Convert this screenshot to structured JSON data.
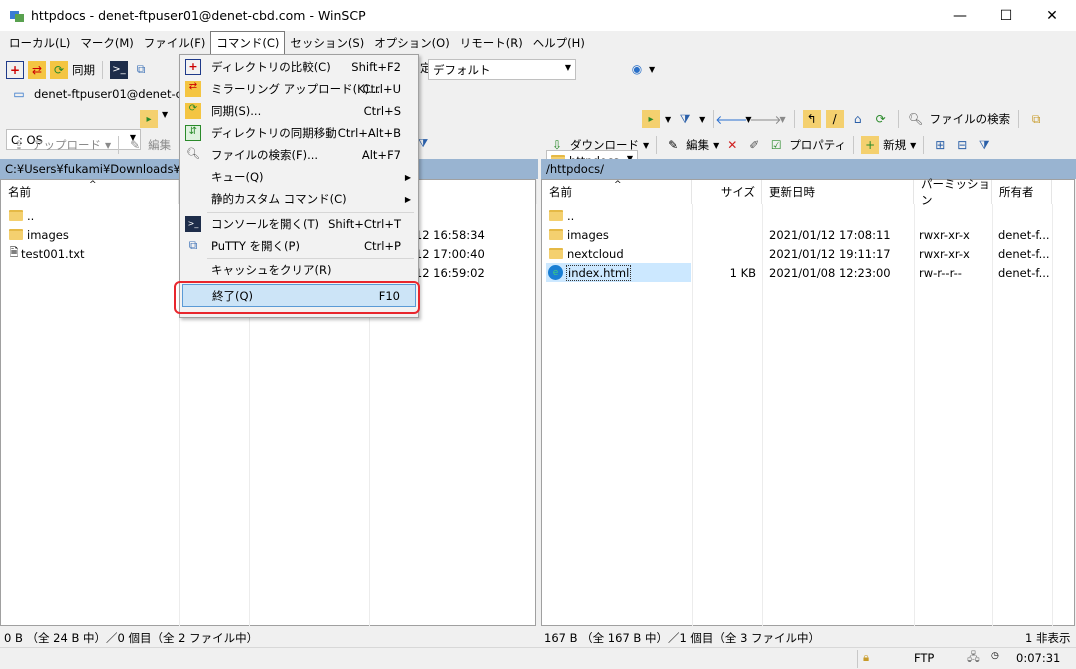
{
  "window": {
    "title": "httpdocs - denet-ftpuser01@denet-cbd.com - WinSCP",
    "minimize": "—",
    "maximize": "☐",
    "close": "✕"
  },
  "menubar": {
    "items": [
      "ローカル(L)",
      "マーク(M)",
      "ファイル(F)",
      "コマンド(C)",
      "セッション(S)",
      "オプション(O)",
      "リモート(R)",
      "ヘルプ(H)"
    ]
  },
  "toolbar": {
    "sync_label": "同期",
    "transfer_setting": "デフォルト"
  },
  "session": {
    "label": "denet-ftpuser01@denet-cbd"
  },
  "left": {
    "drive": "C: OS",
    "upload": "アップロード",
    "edit": "編集",
    "path": "C:¥Users¥fukami¥Downloads¥htt",
    "col_name": "名前",
    "col_date": "時",
    "rows": [
      {
        "name": "..",
        "date": ""
      },
      {
        "name": "images",
        "date": "/12  16:58:34"
      },
      {
        "name": "test001.txt",
        "date": "/12  17:00:40"
      },
      {
        "name": "",
        "date": "/12  16:59:02"
      }
    ],
    "status": "0 B （全 24 B 中）／0 個目（全 2 ファイル中）"
  },
  "right": {
    "dir": "httpdocs",
    "download": "ダウンロード",
    "edit": "編集",
    "properties": "プロパティ",
    "new": "新規",
    "find": "ファイルの検索",
    "path": "/httpdocs/",
    "cols": {
      "name": "名前",
      "size": "サイズ",
      "date": "更新日時",
      "perm": "パーミッション",
      "owner": "所有者"
    },
    "rows": [
      {
        "name": "..",
        "size": "",
        "date": "",
        "perm": "",
        "owner": ""
      },
      {
        "name": "images",
        "size": "",
        "date": "2021/01/12 17:08:11",
        "perm": "rwxr-xr-x",
        "owner": "denet-f..."
      },
      {
        "name": "nextcloud",
        "size": "",
        "date": "2021/01/12 19:11:17",
        "perm": "rwxr-xr-x",
        "owner": "denet-f..."
      },
      {
        "name": "index.html",
        "size": "1 KB",
        "date": "2021/01/08 12:23:00",
        "perm": "rw-r--r--",
        "owner": "denet-f..."
      }
    ],
    "status": "167 B （全 167 B 中）／1 個目（全 3 ファイル中）",
    "hidden": "1 非表示"
  },
  "statusbar": {
    "protocol": "FTP",
    "time": "0:07:31"
  },
  "command_menu": {
    "items": [
      {
        "label": "ディレクトリの比較(C)",
        "shortcut": "Shift+F2"
      },
      {
        "label": "ミラーリング アップロード(K)...",
        "shortcut": "Ctrl+U"
      },
      {
        "label": "同期(S)...",
        "shortcut": "Ctrl+S"
      },
      {
        "label": "ディレクトリの同期移動",
        "shortcut": "Ctrl+Alt+B"
      },
      {
        "label": "ファイルの検索(F)...",
        "shortcut": "Alt+F7"
      },
      {
        "label": "キュー(Q)",
        "shortcut": ""
      },
      {
        "label": "静的カスタム コマンド(C)",
        "shortcut": ""
      },
      {
        "label": "コンソールを開く(T)",
        "shortcut": "Shift+Ctrl+T"
      },
      {
        "label": "PuTTY を開く(P)",
        "shortcut": "Ctrl+P"
      },
      {
        "label": "キャッシュをクリア(R)",
        "shortcut": ""
      },
      {
        "label": "終了(Q)",
        "shortcut": "F10"
      }
    ]
  }
}
